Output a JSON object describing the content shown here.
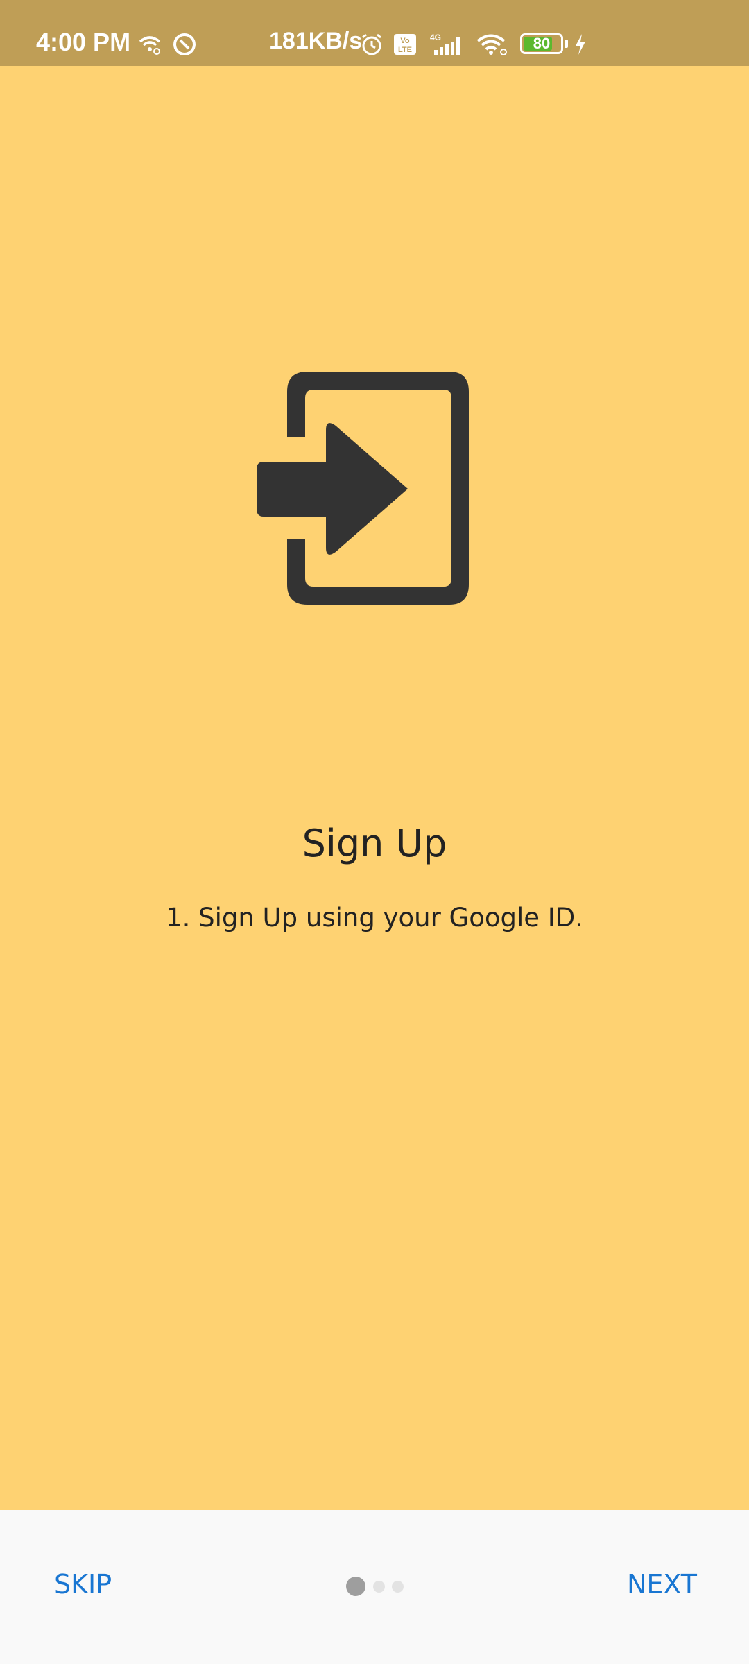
{
  "status_bar": {
    "time": "4:00 PM",
    "net_speed": "181KB/s",
    "battery": "80",
    "battery_level": 0.8,
    "network_type": "4G",
    "volte": "Vo LTE"
  },
  "onboarding": {
    "icon": "login-icon",
    "title": "Sign Up",
    "description": "1. Sign Up using your Google ID."
  },
  "footer": {
    "skip_label": "SKIP",
    "next_label": "NEXT",
    "page_count": 3,
    "active_page": 1
  },
  "colors": {
    "background": "#FED272",
    "status_bar": "#BF9E56",
    "icon": "#333333",
    "accent": "#1976D2",
    "footer": "#F9F9F9"
  }
}
